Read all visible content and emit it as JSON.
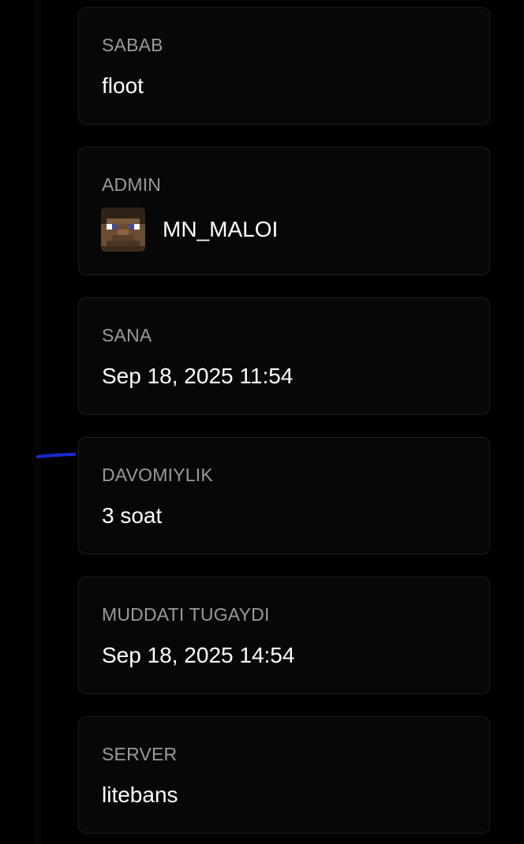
{
  "cards": [
    {
      "label": "SABAB",
      "value": "floot"
    },
    {
      "label": "ADMIN",
      "value": "MN_MALOI"
    },
    {
      "label": "SANA",
      "value": "Sep 18, 2025 11:54"
    },
    {
      "label": "DAVOMIYLIK",
      "value": "3 soat"
    },
    {
      "label": "MUDDATI TUGAYDI",
      "value": "Sep 18, 2025 14:54"
    },
    {
      "label": "SERVER",
      "value": "litebans"
    }
  ],
  "colors": {
    "background": "#000000",
    "card_background": "#070707",
    "card_border": "#1b1b1b",
    "label": "#9a9a9a",
    "value": "#ffffff",
    "pen_mark": "#1a2ad6"
  },
  "icons": {
    "admin_avatar": "minecraft-head-avatar"
  }
}
